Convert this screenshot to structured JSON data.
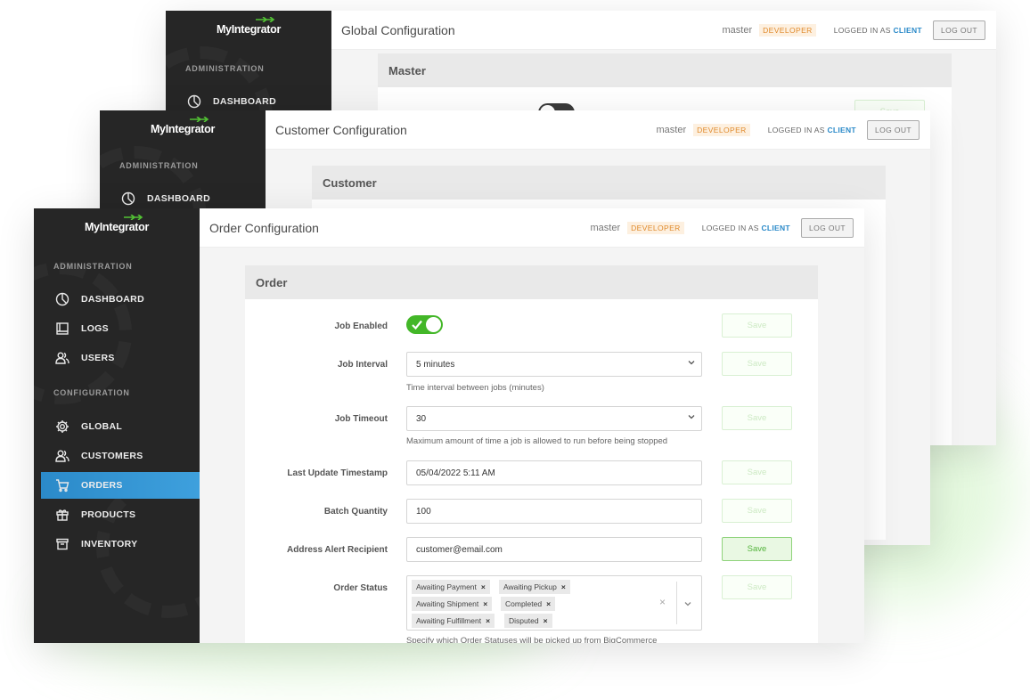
{
  "brand": {
    "logo_text": "MyIntegrator"
  },
  "colors": {
    "accent_blue": "#2b8ac9",
    "toggle_green": "#43b728",
    "badge_orange": "#e08a2c",
    "sidebar_bg": "#262626"
  },
  "header": {
    "env": "master",
    "badge": "DEVELOPER",
    "logged_in_prefix": "LOGGED IN AS",
    "logged_in_user": "CLIENT",
    "logout_label": "LOG OUT"
  },
  "windows": {
    "global": {
      "title": "Global Configuration",
      "panel_title": "Master",
      "sidebar": {
        "section": "ADMINISTRATION",
        "item": "DASHBOARD"
      }
    },
    "customer": {
      "title": "Customer Configuration",
      "panel_title": "Customer",
      "sidebar": {
        "section": "ADMINISTRATION",
        "item": "DASHBOARD"
      }
    },
    "order": {
      "title": "Order Configuration",
      "panel_title": "Order",
      "sidebar": {
        "section_admin": "ADMINISTRATION",
        "section_config": "CONFIGURATION",
        "items": [
          {
            "label": "DASHBOARD",
            "icon": "dashboard-icon"
          },
          {
            "label": "LOGS",
            "icon": "logs-icon"
          },
          {
            "label": "USERS",
            "icon": "users-icon"
          },
          {
            "label": "GLOBAL",
            "icon": "gear-icon"
          },
          {
            "label": "CUSTOMERS",
            "icon": "customers-icon"
          },
          {
            "label": "ORDERS",
            "icon": "cart-icon",
            "active": true
          },
          {
            "label": "PRODUCTS",
            "icon": "gift-icon"
          },
          {
            "label": "INVENTORY",
            "icon": "archive-icon"
          }
        ]
      },
      "form": {
        "save_label": "Save",
        "job_enabled": {
          "label": "Job Enabled",
          "value": true
        },
        "job_interval": {
          "label": "Job Interval",
          "value": "5 minutes",
          "help": "Time interval between jobs (minutes)"
        },
        "job_timeout": {
          "label": "Job Timeout",
          "value": "30",
          "help": "Maximum amount of time a job is allowed to run before being stopped"
        },
        "last_update": {
          "label": "Last Update Timestamp",
          "value": "05/04/2022 5:11 AM"
        },
        "batch_quantity": {
          "label": "Batch Quantity",
          "value": "100"
        },
        "address_alert": {
          "label": "Address Alert Recipient",
          "value": "customer@email.com"
        },
        "order_status": {
          "label": "Order Status",
          "chips": [
            "Awaiting Payment",
            "Awaiting Pickup",
            "Awaiting Shipment",
            "Completed",
            "Awaiting Fulfillment",
            "Disputed"
          ],
          "help": "Specify which Order Statuses will be picked up from BigCommerce"
        }
      }
    }
  }
}
